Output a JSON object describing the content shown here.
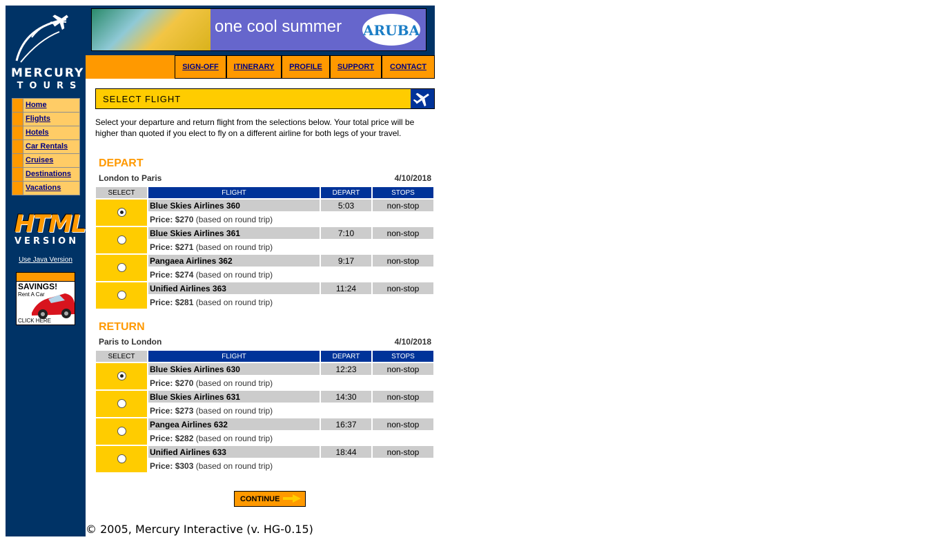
{
  "brand": {
    "line1": "MERCURY",
    "line2": "TOURS"
  },
  "sidebar": {
    "items": [
      {
        "label": "Home"
      },
      {
        "label": "Flights"
      },
      {
        "label": "Hotels"
      },
      {
        "label": "Car Rentals"
      },
      {
        "label": "Cruises"
      },
      {
        "label": "Destinations"
      },
      {
        "label": "Vacations"
      }
    ],
    "html_version": {
      "word1": "HTML",
      "word2": "VERSION"
    },
    "java_link": "Use Java Version",
    "ad": {
      "title": "SAVINGS!",
      "sub": "Rent A Car",
      "cta": "CLICK HERE"
    }
  },
  "banner": {
    "text": "one cool summer",
    "logo": "ARUBA"
  },
  "topnav": [
    "SIGN-OFF",
    "ITINERARY",
    "PROFILE",
    "SUPPORT",
    "CONTACT"
  ],
  "page": {
    "title": "SELECT FLIGHT",
    "intro": "Select your departure and return flight from the selections below. Your total price will be higher than quoted if you elect to fly on a different airline for both legs of your travel."
  },
  "columns": {
    "select": "SELECT",
    "flight": "FLIGHT",
    "depart": "DEPART",
    "stops": "STOPS"
  },
  "price_prefix": "Price:",
  "price_suffix": "(based on round trip)",
  "depart": {
    "title": "DEPART",
    "route": "London to Paris",
    "date": "4/10/2018",
    "flights": [
      {
        "airline": "Blue Skies Airlines 360",
        "time": "5:03",
        "stops": "non-stop",
        "price": "$270",
        "selected": true
      },
      {
        "airline": "Blue Skies Airlines 361",
        "time": "7:10",
        "stops": "non-stop",
        "price": "$271",
        "selected": false
      },
      {
        "airline": "Pangaea Airlines 362",
        "time": "9:17",
        "stops": "non-stop",
        "price": "$274",
        "selected": false
      },
      {
        "airline": "Unified Airlines 363",
        "time": "11:24",
        "stops": "non-stop",
        "price": "$281",
        "selected": false
      }
    ]
  },
  "return": {
    "title": "RETURN",
    "route": "Paris to London",
    "date": "4/10/2018",
    "flights": [
      {
        "airline": "Blue Skies Airlines 630",
        "time": "12:23",
        "stops": "non-stop",
        "price": "$270",
        "selected": true
      },
      {
        "airline": "Blue Skies Airlines 631",
        "time": "14:30",
        "stops": "non-stop",
        "price": "$273",
        "selected": false
      },
      {
        "airline": "Pangea Airlines 632",
        "time": "16:37",
        "stops": "non-stop",
        "price": "$282",
        "selected": false
      },
      {
        "airline": "Unified Airlines 633",
        "time": "18:44",
        "stops": "non-stop",
        "price": "$303",
        "selected": false
      }
    ]
  },
  "continue_label": "CONTINUE",
  "footer": "© 2005, Mercury Interactive (v. HG-0.15)",
  "colors": {
    "navy": "#003366",
    "orange": "#ff9900",
    "yellow": "#ffcc00",
    "blue_header": "#003399"
  }
}
